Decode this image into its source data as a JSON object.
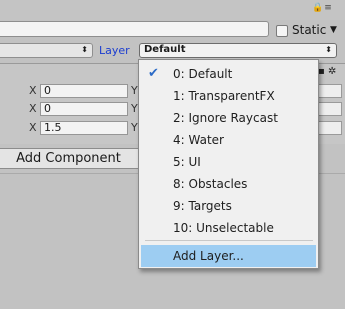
{
  "header": {
    "static_label": "Static",
    "static_arrow_icon": "triangle-down",
    "layer_label": "Layer",
    "layer_value": "Default",
    "tag_value": ""
  },
  "transform": {
    "rows": [
      {
        "axis": "X",
        "value": "0"
      },
      {
        "axis": "X",
        "value": "0"
      },
      {
        "axis": "X",
        "value": "1.5"
      }
    ],
    "right_axis": "Y"
  },
  "add_component_label": "Add Component",
  "layer_menu": {
    "items": [
      {
        "label": "0: Default",
        "checked": true
      },
      {
        "label": "1: TransparentFX",
        "checked": false
      },
      {
        "label": "2: Ignore Raycast",
        "checked": false
      },
      {
        "label": "4: Water",
        "checked": false
      },
      {
        "label": "5: UI",
        "checked": false
      },
      {
        "label": "8: Obstacles",
        "checked": false
      },
      {
        "label": "9: Targets",
        "checked": false
      },
      {
        "label": "10: Unselectable",
        "checked": false
      }
    ],
    "add_layer_label": "Add Layer...",
    "check_mark": "✔"
  }
}
